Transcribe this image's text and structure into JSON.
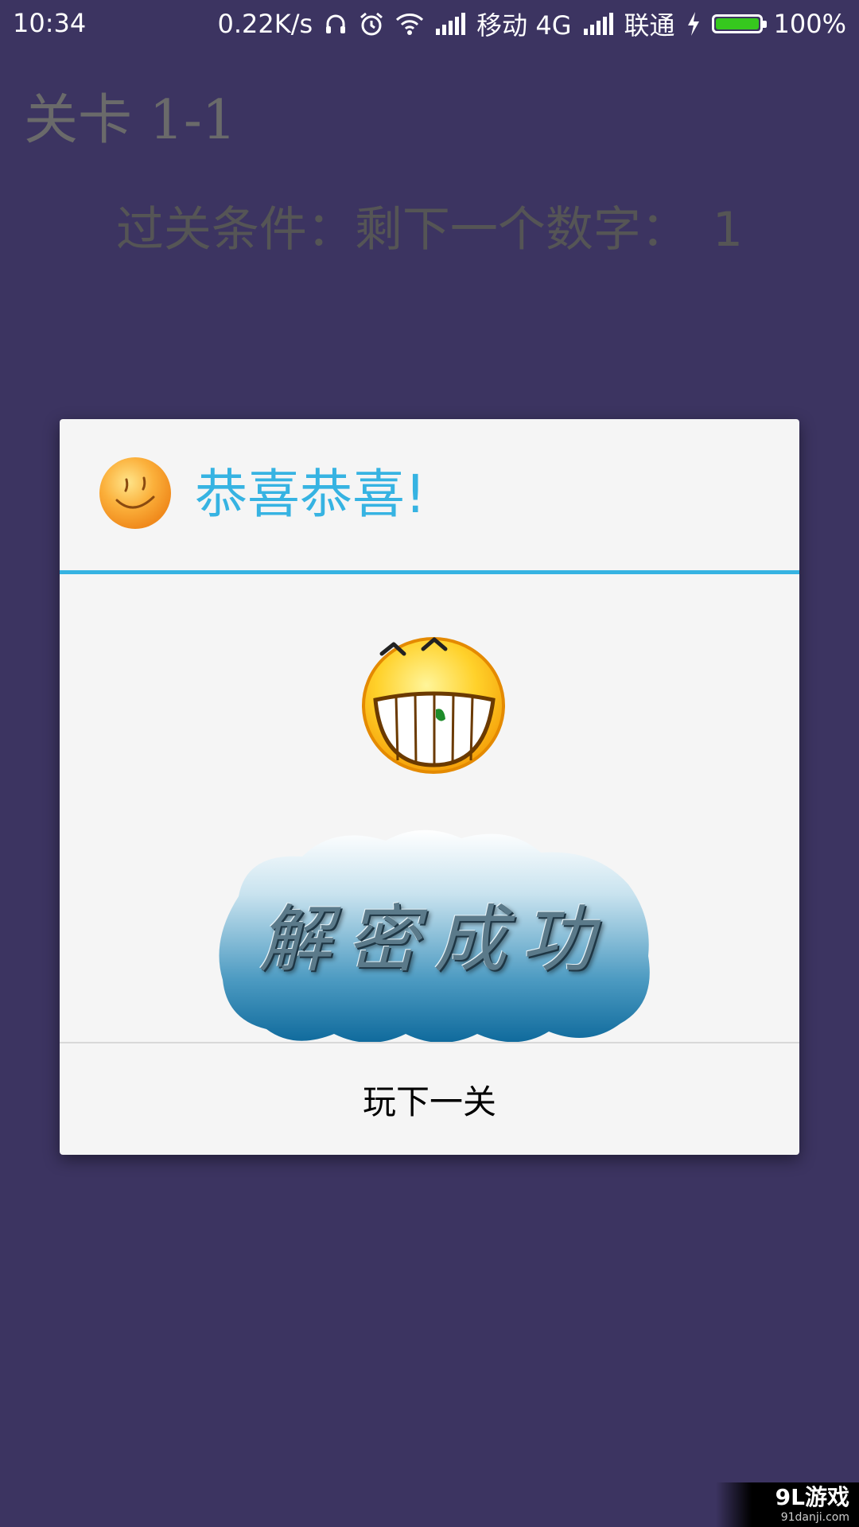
{
  "status_bar": {
    "time": "10:34",
    "net_speed": "0.22K/s",
    "carrier1": "移动 4G",
    "carrier2": "联通",
    "battery": "100%",
    "battery_level": 1.0,
    "icons": [
      "headphones-icon",
      "alarm-icon",
      "wifi-icon",
      "signal-icon",
      "signal-icon",
      "charging-icon",
      "battery-icon"
    ]
  },
  "game": {
    "level_title": "关卡 1-1",
    "condition_label": "过关条件：剩下一个数字：",
    "condition_value": "1"
  },
  "dialog": {
    "title": "恭喜恭喜!",
    "header_icon": "smiley-icon",
    "body_icon": "grinning-face-icon",
    "banner_text": "解密成功",
    "button_label": "玩下一关"
  },
  "watermark": {
    "main": "9L游戏",
    "sub": "91danji.com"
  },
  "colors": {
    "background": "#3c3461",
    "accent": "#36b3e2",
    "dialog_bg": "#f5f5f5",
    "battery_green": "#36c81e"
  }
}
